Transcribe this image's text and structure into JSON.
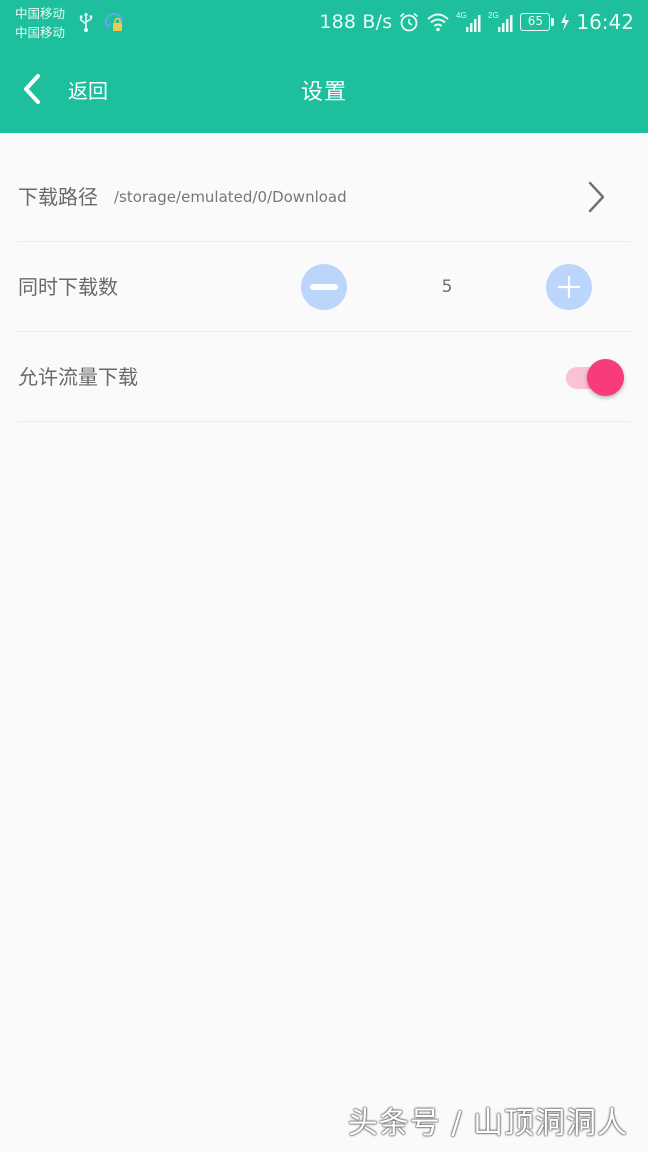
{
  "status_bar": {
    "carrier_1": "中国移动",
    "carrier_2": "中国移动",
    "net_speed": "188 B/s",
    "signal_1_type": "4G",
    "signal_2_type": "2G",
    "battery": "65",
    "time": "16:42",
    "icons": [
      "usb-icon",
      "sync-lock-icon",
      "alarm-icon",
      "wifi-icon",
      "signal-icon",
      "signal-icon",
      "battery-icon",
      "charging-bolt-icon"
    ]
  },
  "toolbar": {
    "back_label": "返回",
    "title": "设置",
    "back_icon": "chevron-left-icon"
  },
  "settings": {
    "download_path": {
      "label": "下载路径",
      "value": "/storage/emulated/0/Download",
      "icon": "chevron-right-icon"
    },
    "concurrent_downloads": {
      "label": "同时下载数",
      "value": "5"
    },
    "allow_mobile_data": {
      "label": "允许流量下载",
      "enabled": true
    }
  },
  "colors": {
    "primary": "#1dbf9c",
    "stepper": "#bcd6fb",
    "toggle_thumb": "#f73c79",
    "toggle_track": "#fbc1d4",
    "background": "#fafafa"
  },
  "watermark": "头条号 / 山顶洞洞人"
}
